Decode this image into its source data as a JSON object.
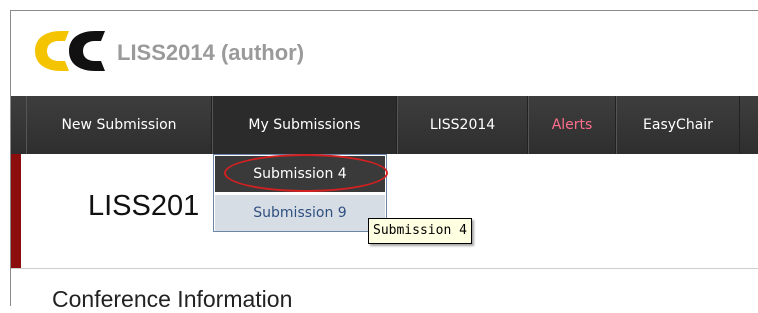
{
  "header": {
    "title": "LISS2014 (author)",
    "logo": {
      "text": "EC",
      "icon": "easychair-logo-icon",
      "colors": {
        "yellow": "#f4c400",
        "black": "#111111"
      }
    }
  },
  "nav": {
    "items": [
      {
        "label": "New Submission"
      },
      {
        "label": "My Submissions"
      },
      {
        "label": "LISS2014"
      },
      {
        "label": "Alerts",
        "color": "#ff6e8a"
      },
      {
        "label": "EasyChair"
      }
    ]
  },
  "dropdown": {
    "items": [
      {
        "label": "Submission 4"
      },
      {
        "label": "Submission 9"
      }
    ]
  },
  "tooltip": {
    "text": "Submission 4"
  },
  "main": {
    "title": "LISS201",
    "section_heading": "Conference Information"
  },
  "colors": {
    "navbar": "#333333",
    "accent_bar": "#8b0d0d",
    "highlight_oval": "#d42020"
  }
}
